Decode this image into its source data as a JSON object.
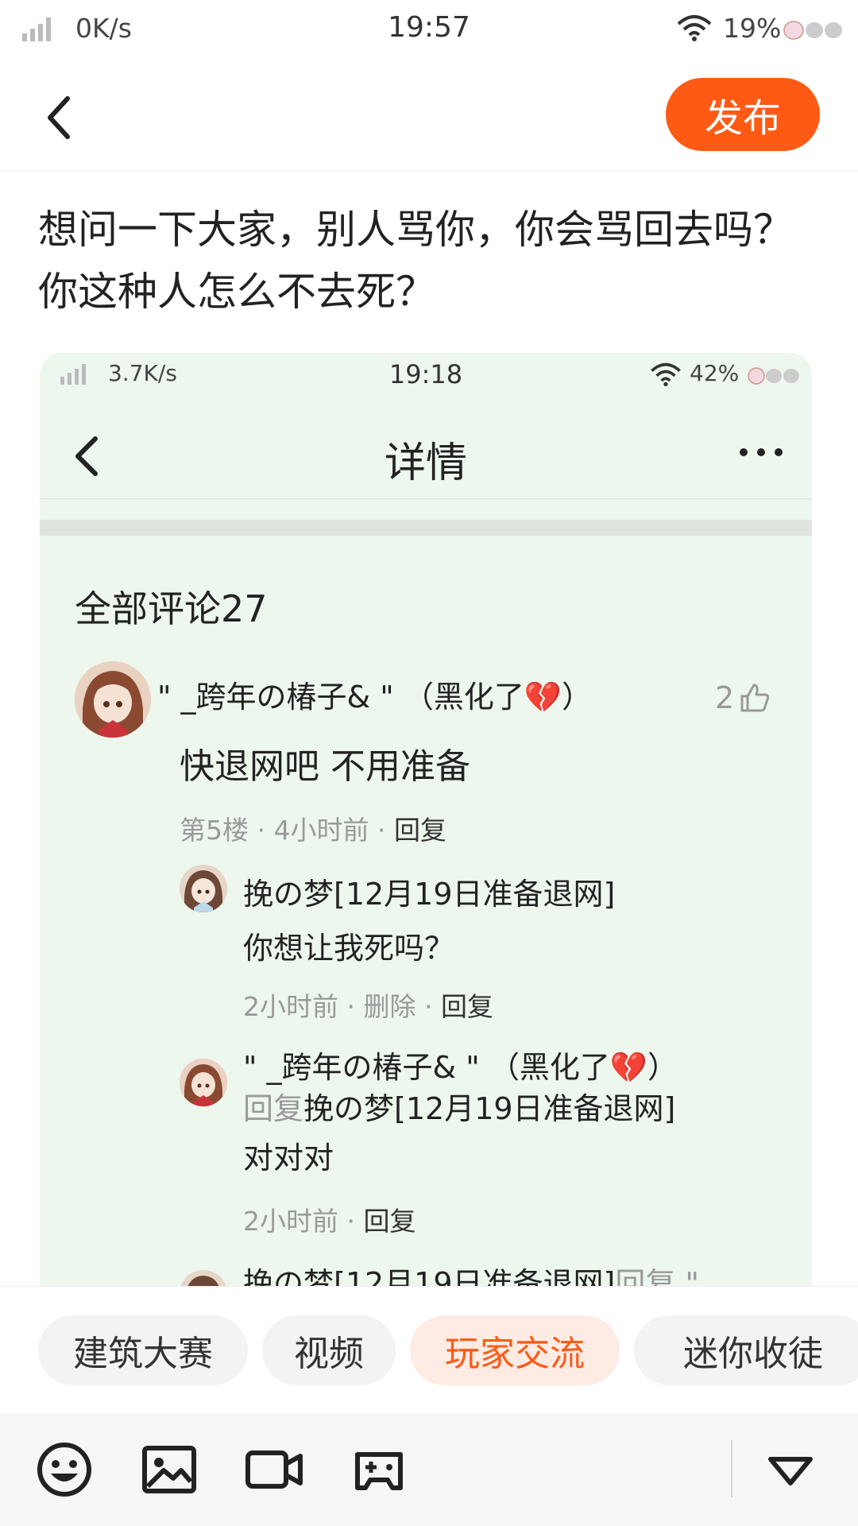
{
  "status_bar": {
    "network_speed": "0K/s",
    "time": "19:57",
    "battery": "19%"
  },
  "header": {
    "publish_label": "发布"
  },
  "post": {
    "title": "想问一下大家，别人骂你，你会骂回去吗？你这种人怎么不去死？"
  },
  "embedded_screenshot": {
    "status_bar": {
      "network_speed": "3.7K/s",
      "time": "19:18",
      "battery": "42%"
    },
    "nav_title": "详情",
    "comments_header": "全部评论27",
    "comment": {
      "author": "\" _跨年の椿子& \" （黑化了💔）",
      "likes": "2",
      "text": "快退网吧  不用准备",
      "meta_floor": "第5楼 · 4小时前 · ",
      "meta_reply": "回复"
    },
    "replies": [
      {
        "author": "挽の梦[12月19日准备退网]",
        "text": "你想让我死吗？",
        "meta": "2小时前 · 删除 · ",
        "meta_reply": "回复"
      },
      {
        "author": "\" _跨年の椿子& \" （黑化了💔）",
        "reply_word": "回复",
        "reply_to": "挽の梦[12月19日准备退网]",
        "text": "对对对",
        "meta": "2小时前 · ",
        "meta_reply": "回复"
      },
      {
        "author_partial": "挽の梦[12月19日准备退网]",
        "reply_word_partial": "回复 \""
      }
    ]
  },
  "tags": [
    {
      "label": "建筑大赛",
      "active": false
    },
    {
      "label": "视频",
      "active": false
    },
    {
      "label": "玩家交流",
      "active": true
    },
    {
      "label": "迷你收徒",
      "active": false
    }
  ],
  "toolbar": {
    "icons": [
      "emoji-icon",
      "image-icon",
      "video-icon",
      "gamepad-icon",
      "collapse-icon"
    ]
  },
  "colors": {
    "accent": "#ff5a14",
    "screenshot_bg": "#eef7ee"
  }
}
